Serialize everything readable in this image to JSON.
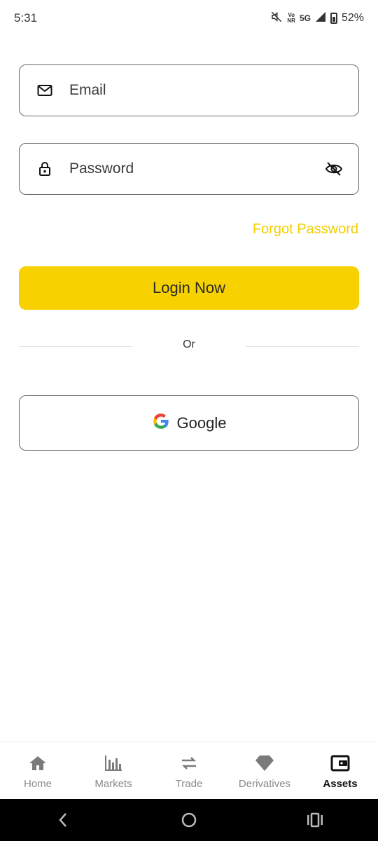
{
  "status_bar": {
    "time": "5:31",
    "volte": "Vo",
    "nr": "NR",
    "network": "5G",
    "battery": "52%"
  },
  "form": {
    "email_placeholder": "Email",
    "password_placeholder": "Password",
    "forgot_password": "Forgot Password",
    "login_button": "Login Now",
    "or_text": "Or",
    "google_button": "Google"
  },
  "bottom_nav": {
    "items": [
      {
        "label": "Home",
        "icon": "home-icon"
      },
      {
        "label": "Markets",
        "icon": "bar-chart-icon"
      },
      {
        "label": "Trade",
        "icon": "swap-arrows-icon"
      },
      {
        "label": "Derivatives",
        "icon": "diamond-icon"
      },
      {
        "label": "Assets",
        "icon": "wallet-icon",
        "active": true
      }
    ]
  },
  "colors": {
    "accent": "#f7d200",
    "forgot_link": "#f2cf00",
    "border": "#6b6b6b"
  }
}
